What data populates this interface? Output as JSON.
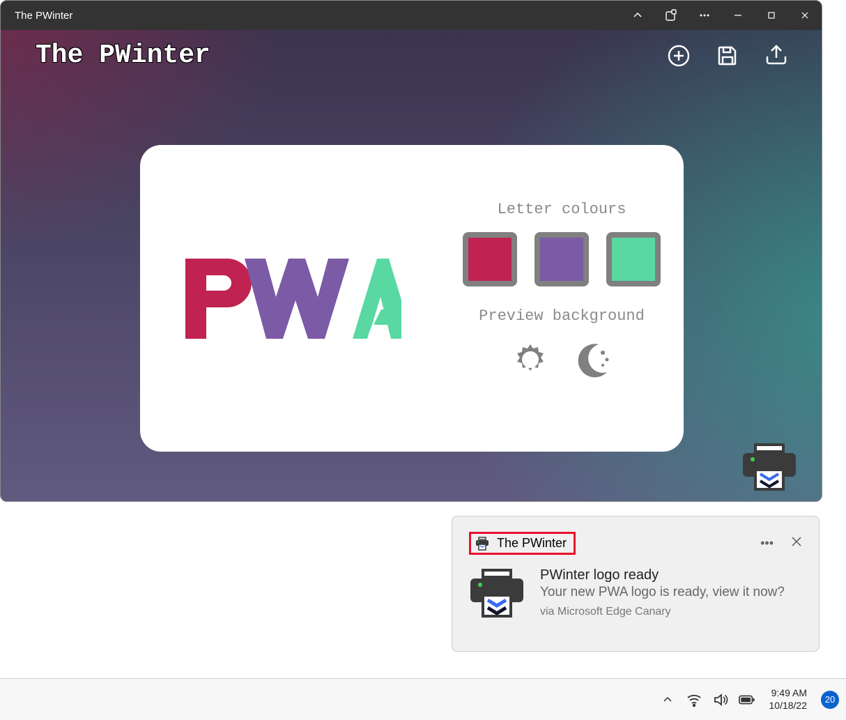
{
  "window": {
    "title": "The PWinter"
  },
  "app": {
    "title": "The PWinter",
    "labels": {
      "letter_colours": "Letter colours",
      "preview_bg": "Preview background"
    },
    "swatches": [
      "#c02351",
      "#7b5aa6",
      "#59d8a2"
    ]
  },
  "notification": {
    "app_name": "The PWinter",
    "title": "PWinter logo ready",
    "message": "Your new PWA logo is ready, view it now?",
    "via": "via Microsoft Edge Canary"
  },
  "taskbar": {
    "time": "9:49 AM",
    "date": "10/18/22",
    "badge": "20"
  }
}
